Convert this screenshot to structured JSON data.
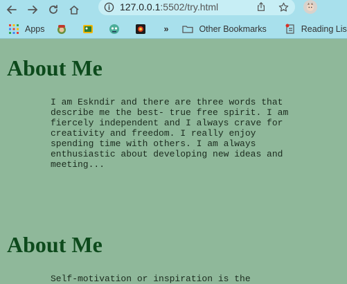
{
  "browser": {
    "url_host": "127.0.0.1",
    "url_path": ":5502/try.html",
    "bookmarks": {
      "apps": "Apps",
      "overflow": "»",
      "other": "Other Bookmarks",
      "reading": "Reading List"
    }
  },
  "sections": [
    {
      "heading": "About Me",
      "text": "I am Eskndir and there are three words that describe me the best- true free spirit. I am fiercely independent and I always crave for creativity and freedom. I really enjoy spending time with others. I am always enthusiastic about developing new ideas and meeting..."
    },
    {
      "heading": "About Me",
      "text": "Self-motivation or inspiration is the"
    }
  ]
}
